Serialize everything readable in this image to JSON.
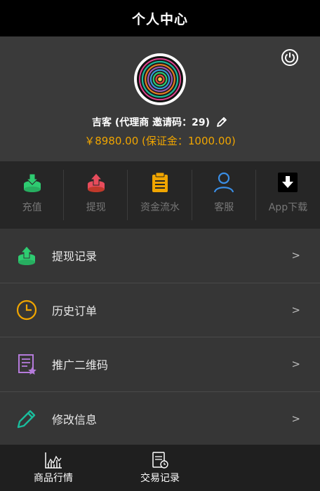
{
  "header": {
    "title": "个人中心"
  },
  "profile": {
    "name": "吉客 (代理商 邀请码：29)",
    "balance": "￥8980.00 (保证金：1000.00)",
    "power_icon": "power-icon",
    "edit_icon": "pencil-icon"
  },
  "quick_actions": [
    {
      "label": "充值",
      "icon": "deposit-icon",
      "color": "#2ecc71"
    },
    {
      "label": "提现",
      "icon": "withdraw-icon",
      "color": "#e74c5c"
    },
    {
      "label": "资金流水",
      "icon": "clipboard-icon",
      "color": "#f0a500"
    },
    {
      "label": "客服",
      "icon": "user-icon",
      "color": "#3a8ee6"
    },
    {
      "label": "App下载",
      "icon": "download-icon",
      "color": "#ffffff"
    }
  ],
  "menu": [
    {
      "label": "提现记录",
      "arrow": ">",
      "icon": "withdraw-record-icon",
      "color": "#2ecc71"
    },
    {
      "label": "历史订单",
      "arrow": ">",
      "icon": "clock-icon",
      "color": "#f0a500"
    },
    {
      "label": "推广二维码",
      "arrow": ">",
      "icon": "document-star-icon",
      "color": "#b57bdb"
    },
    {
      "label": "修改信息",
      "arrow": ">",
      "icon": "pencil-icon",
      "color": "#1abc9c"
    }
  ],
  "bottom_nav": [
    {
      "label": "商品行情",
      "icon": "chart-icon"
    },
    {
      "label": "交易记录",
      "icon": "record-icon"
    }
  ]
}
